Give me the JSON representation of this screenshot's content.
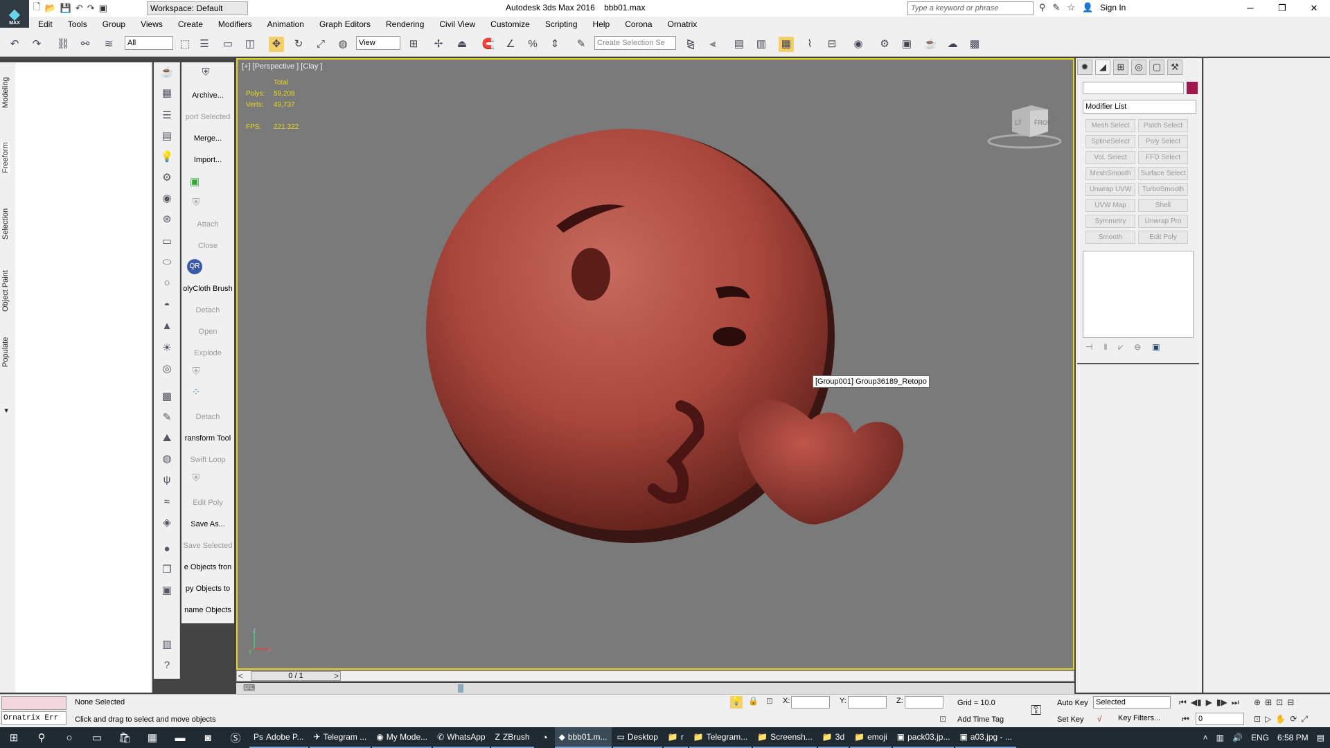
{
  "app": {
    "title": "Autodesk 3ds Max 2016",
    "file": "bbb01.max",
    "workspace": "Workspace: Default",
    "logo_text": "MAX",
    "search_placeholder": "Type a keyword or phrase",
    "sign_in": "Sign In"
  },
  "menus": [
    "Edit",
    "Tools",
    "Group",
    "Views",
    "Create",
    "Modifiers",
    "Animation",
    "Graph Editors",
    "Rendering",
    "Civil View",
    "Customize",
    "Scripting",
    "Help",
    "Corona",
    "Ornatrix"
  ],
  "toolbar": {
    "filter": "All",
    "ref_coord": "View",
    "selection_set_placeholder": "Create Selection Se"
  },
  "ribbon_tabs": [
    "Modeling",
    "Freeform",
    "Selection",
    "Object Paint",
    "Populate"
  ],
  "commands": [
    {
      "label": "Archive...",
      "dim": false
    },
    {
      "label": "port Selected",
      "dim": true
    },
    {
      "label": "Merge...",
      "dim": false
    },
    {
      "label": "Import...",
      "dim": false
    },
    {
      "label": "Attach",
      "dim": true
    },
    {
      "label": "Close",
      "dim": true
    },
    {
      "label": "olyCloth Brush",
      "dim": false
    },
    {
      "label": "Detach",
      "dim": true
    },
    {
      "label": "Open",
      "dim": true
    },
    {
      "label": "Explode",
      "dim": true
    },
    {
      "label": "Detach",
      "dim": true
    },
    {
      "label": "ransform Tool",
      "dim": false
    },
    {
      "label": "Swift Loop",
      "dim": true
    },
    {
      "label": "Edit Poly",
      "dim": true
    },
    {
      "label": "Save As...",
      "dim": false
    },
    {
      "label": "Save Selected",
      "dim": true
    },
    {
      "label": "e Objects fron",
      "dim": false
    },
    {
      "label": "py Objects to",
      "dim": false
    },
    {
      "label": "name Objects",
      "dim": false
    }
  ],
  "viewport": {
    "label": "[+] [Perspective ] [Clay ]",
    "stats_total": "Total",
    "polys_label": "Polys:",
    "polys": "59,208",
    "verts_label": "Verts:",
    "verts": "49,737",
    "fps_label": "FPS:",
    "fps": "221.322",
    "navcube_front": "FRONT",
    "navcube_left": "LT",
    "tooltip": "[Group001] Group36189_Retopo",
    "axis_y": "y",
    "axis_z": "z",
    "axis_x": "x"
  },
  "timeline": {
    "frame": "0 / 1"
  },
  "command_panel": {
    "modifier_list": "Modifier List",
    "object_color": "#a0174d",
    "modifier_buttons": [
      "Mesh Select",
      "Patch Select",
      "SplineSelect",
      "Poly Select",
      "Vol. Select",
      "FFD Select",
      "MeshSmooth",
      "Surface Select",
      "Unwrap UVW",
      "TurboSmooth",
      "UVW Map",
      "Shell",
      "Symmetry",
      "Unwrap Pro",
      "Smooth",
      "Edit Poly"
    ]
  },
  "status": {
    "maxscript_error": "Ornatrix Err",
    "selection": "None Selected",
    "hint": "Click and drag to select and move objects",
    "x_label": "X:",
    "y_label": "Y:",
    "z_label": "Z:",
    "grid": "Grid = 10.0",
    "add_time_tag": "Add Time Tag",
    "auto_key": "Auto Key",
    "set_key": "Set Key",
    "selected_set": "Selected",
    "key_filters": "Key Filters...",
    "current_frame": "0"
  },
  "taskbar": {
    "items": [
      "Adobe P...",
      "Telegram ...",
      "My Mode...",
      "WhatsApp",
      "ZBrush",
      "bbb01.m...",
      "Desktop",
      "r",
      "Telegram...",
      "Screensh...",
      "3d",
      "emoji",
      "pack03.jp...",
      "a03.jpg - ..."
    ],
    "lang": "ENG",
    "time": "6:58 PM"
  }
}
